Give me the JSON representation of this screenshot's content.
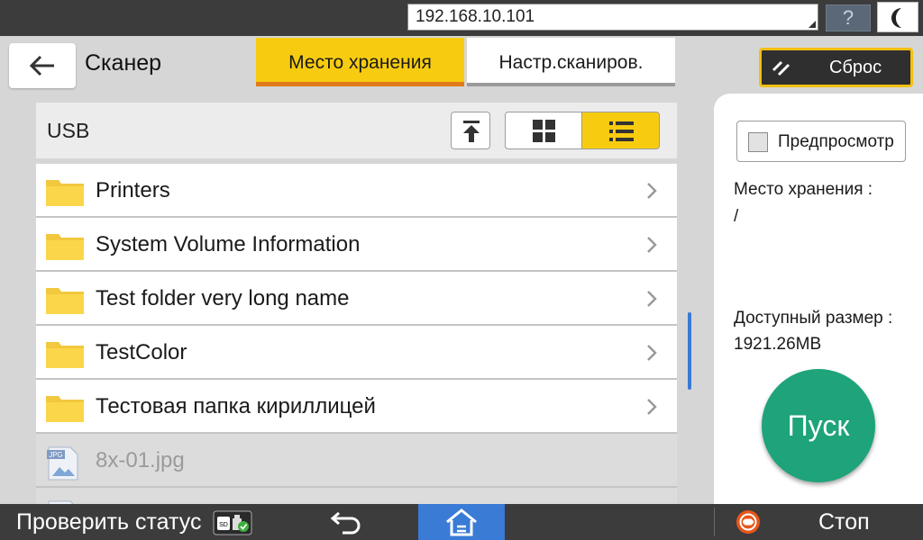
{
  "topbar": {
    "address": "192.168.10.101",
    "help_label": "?",
    "night_icon": "moon-icon"
  },
  "header": {
    "title": "Сканер",
    "back_icon": "back-arrow-icon",
    "tabs": [
      {
        "label": "Место хранения",
        "active": true
      },
      {
        "label": "Настр.сканиров.",
        "active": false
      }
    ],
    "reset_label": "Сброс"
  },
  "location": {
    "label": "USB",
    "view_mode": "list"
  },
  "files": [
    {
      "name": "Printers",
      "type": "folder"
    },
    {
      "name": "System Volume Information",
      "type": "folder"
    },
    {
      "name": "Test folder very long name",
      "type": "folder"
    },
    {
      "name": "TestColor",
      "type": "folder"
    },
    {
      "name": "Тестовая папка кириллицей",
      "type": "folder"
    },
    {
      "name": "8x-01.jpg",
      "type": "jpg",
      "badge": "JPG"
    }
  ],
  "panel": {
    "preview_label": "Предпросмотр",
    "preview_checked": false,
    "storage_label": "Место хранения :",
    "storage_value": "/",
    "size_label": "Доступный размер :",
    "size_value": "1921.26MB",
    "start_label": "Пуск"
  },
  "bottombar": {
    "status_label": "Проверить статус",
    "sd_badge": "SD",
    "stop_label": "Стоп"
  },
  "colors": {
    "accent_yellow": "#f7cc10",
    "tab_underline": "#e07a1a",
    "start_green": "#1ea37a",
    "home_blue": "#3a7bd5",
    "stop_orange": "#e8561a"
  }
}
